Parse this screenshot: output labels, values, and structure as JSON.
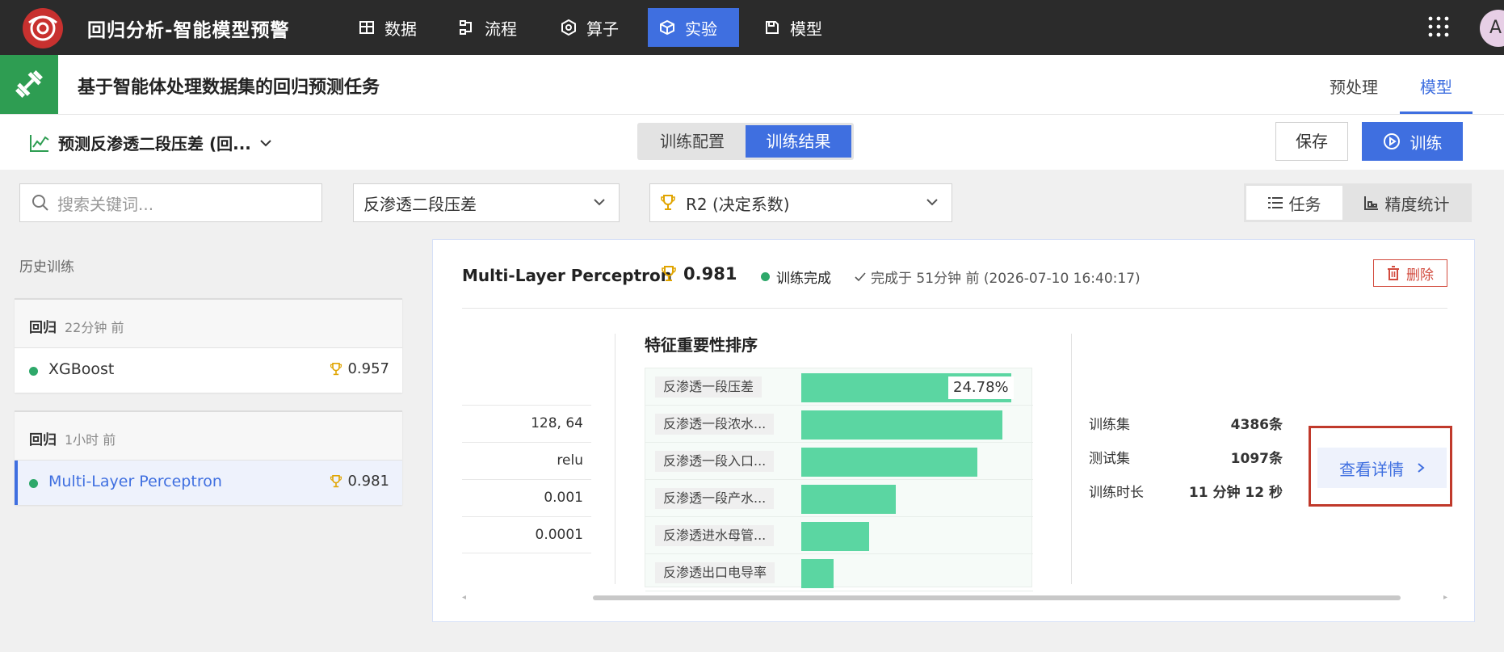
{
  "app": {
    "title": "回归分析-智能模型预警",
    "avatar_letter": "A"
  },
  "nav": [
    {
      "label": "数据",
      "icon": "table-icon"
    },
    {
      "label": "流程",
      "icon": "flow-icon"
    },
    {
      "label": "算子",
      "icon": "hexagon-icon"
    },
    {
      "label": "实验",
      "icon": "cube-icon",
      "active": true
    },
    {
      "label": "模型",
      "icon": "save-icon"
    }
  ],
  "task": {
    "title": "基于智能体处理数据集的回归预测任务",
    "tabs": [
      "预处理",
      "模型"
    ],
    "active_tab": "模型"
  },
  "toolbar": {
    "experiment": "预测反渗透二段压差 (回...",
    "segments": [
      "训练配置",
      "训练结果"
    ],
    "active_segment": "训练结果",
    "save_label": "保存",
    "train_label": "训练"
  },
  "filters": {
    "search_placeholder": "搜索关键词...",
    "target": "反渗透二段压差",
    "metric": "R2 (决定系数)",
    "views": [
      "任务",
      "精度统计"
    ],
    "active_view": "任务"
  },
  "history": {
    "label": "历史训练",
    "groups": [
      {
        "type": "回归",
        "time": "22分钟 前",
        "items": [
          {
            "name": "XGBoost",
            "score": "0.957"
          }
        ]
      },
      {
        "type": "回归",
        "time": "1小时 前",
        "items": [
          {
            "name": "Multi-Layer Perceptron",
            "score": "0.981",
            "selected": true
          }
        ]
      }
    ]
  },
  "result": {
    "model": "Multi-Layer Perceptron",
    "score": "0.981",
    "status": "训练完成",
    "completed": "完成于 51分钟 前 (2026-07-10 16:40:17)",
    "delete_label": "删除",
    "params": [
      "128, 64",
      "relu",
      "0.001",
      "0.0001"
    ],
    "stats": [
      {
        "key": "训练集",
        "value": "4386条"
      },
      {
        "key": "测试集",
        "value": "1097条"
      },
      {
        "key": "训练时长",
        "value": "11 分钟 12 秒"
      }
    ],
    "detail_label": "查看详情"
  },
  "chart_data": {
    "type": "bar",
    "title": "特征重要性排序",
    "categories": [
      "反渗透一段压差",
      "反渗透一段浓水...",
      "反渗透一段入口...",
      "反渗透一段产水...",
      "反渗透进水母管...",
      "反渗透出口电导率"
    ],
    "values": [
      24.78,
      23.8,
      20.8,
      11.2,
      8.0,
      3.8
    ],
    "value_labels": [
      "24.78%",
      "",
      "",
      "",
      "",
      ""
    ],
    "xlim": [
      0,
      25
    ],
    "color": "#5bd6a2"
  }
}
